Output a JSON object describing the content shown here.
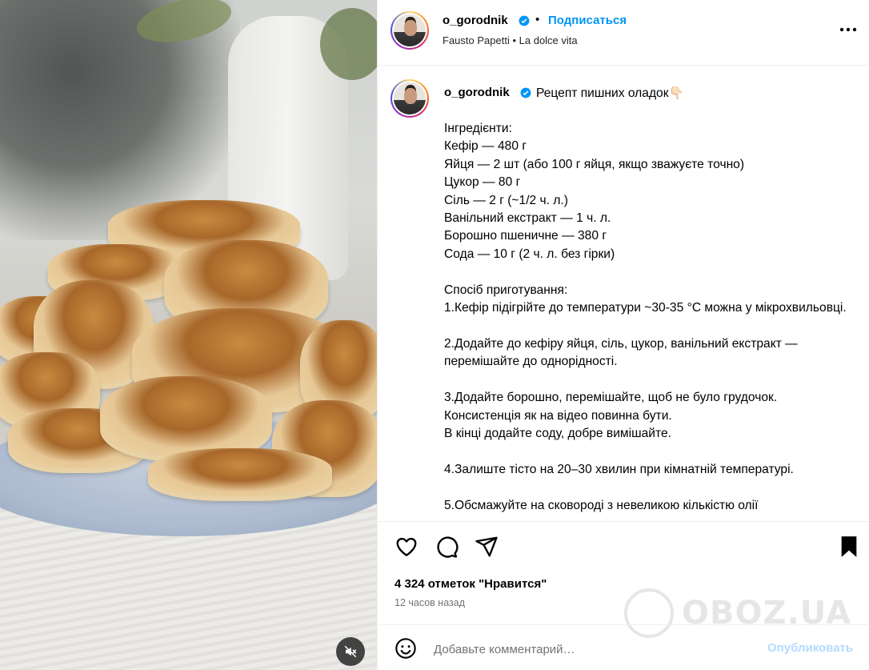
{
  "post": {
    "author": "o_gorodnik",
    "separator": "•",
    "follow_label": "Подписаться",
    "music_artist": "Fausto Papetti",
    "music_separator": "•",
    "music_track": "La dolce vita"
  },
  "caption": {
    "author": "o_gorodnik",
    "title": "Рецепт пишних оладок👇🏻",
    "body": "Інгредієнти:\nКефір — 480 г\nЯйця — 2 шт (або 100 г яйця, якщо зважуєте точно)\nЦукор — 80 г\nСіль — 2 г (~1/2 ч. л.)\nВанільний екстракт — 1 ч. л.\nБорошно пшеничне — 380 г\nСода — 10 г (2 ч. л. без гірки)\n\nСпосіб приготування:\n1.Кефір підігрійте до температури ~30-35 °C можна у мікрохвильовці.\n\n2.Додайте до кефіру яйця, сіль, цукор, ванільний екстракт — перемішайте до однорідності.\n\n3.Додайте борошно, перемішайте, щоб не було грудочок. Консистенція як на відео повинна бути.\nВ кінці додайте соду, добре вимішайте.\n\n4.Залиште тісто на 20–30 хвилин при кімнатній температурі.\n\n5.Обсмажуйте на сковороді з невеликою кількістю олії"
  },
  "stats": {
    "likes": "4 324 отметок \"Нравится\"",
    "time": "12 часов назад"
  },
  "comment": {
    "placeholder": "Добавьте комментарий…",
    "publish_label": "Опубликовать"
  },
  "watermark": {
    "text": "OBOZ.UA"
  },
  "icons": {
    "like": "heart-icon",
    "comment": "comment-icon",
    "share": "share-icon",
    "save": "bookmark-icon",
    "emoji": "emoji-icon",
    "more": "more-icon",
    "verified": "verified-badge-icon",
    "sound": "muted-sound-icon"
  },
  "colors": {
    "accent": "#0095f6",
    "publish_disabled": "#b3dbff",
    "muted_text": "#737373"
  }
}
